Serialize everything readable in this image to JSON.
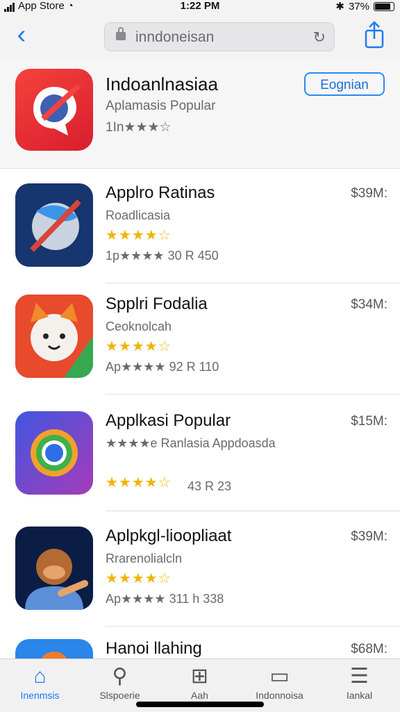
{
  "status": {
    "carrier": "App Store",
    "time": "1:22 PM",
    "battery": "37%"
  },
  "nav": {
    "back_icon": "chevron-left-icon",
    "search_text": "inndoneisan",
    "share_icon": "share-icon"
  },
  "hero": {
    "title": "Indoanlnasiaa",
    "subtitle": "Aplamasis Popular",
    "rating": "1In★★★☆",
    "get_label": "Eognian"
  },
  "apps": [
    {
      "name": "Applro Ratinas",
      "dev": "Roadlicasia",
      "stars": "★★★★☆",
      "meta": "1p★★★★ 30  R 450",
      "price": "$39M:"
    },
    {
      "name": "Spplri Fodalia",
      "dev": "Ceoknolcah",
      "stars": "★★★★☆",
      "meta": "Ap★★★★ 92  R 110",
      "price": "$34M:"
    },
    {
      "name": "Applkasi Popular",
      "dev": "★★★★e Ranlasia  Appdoasda",
      "stars": "★★★★☆",
      "meta": "43  R 23",
      "price": "$15M:"
    },
    {
      "name": "Aplpkgl-lioopliaat",
      "dev": "Rrarenolialcln",
      "stars": "★★★★☆",
      "meta": "Ap★★★★ 311  h 338",
      "price": "$39M:"
    },
    {
      "name": "Hanoi llahing",
      "dev": "",
      "stars": "",
      "meta": "",
      "price": "$68M:"
    }
  ],
  "tabs": [
    {
      "label": "Inenmsis"
    },
    {
      "label": "Slspoerie"
    },
    {
      "label": "Aah"
    },
    {
      "label": "Indonnoisa"
    },
    {
      "label": "Iankal"
    }
  ]
}
